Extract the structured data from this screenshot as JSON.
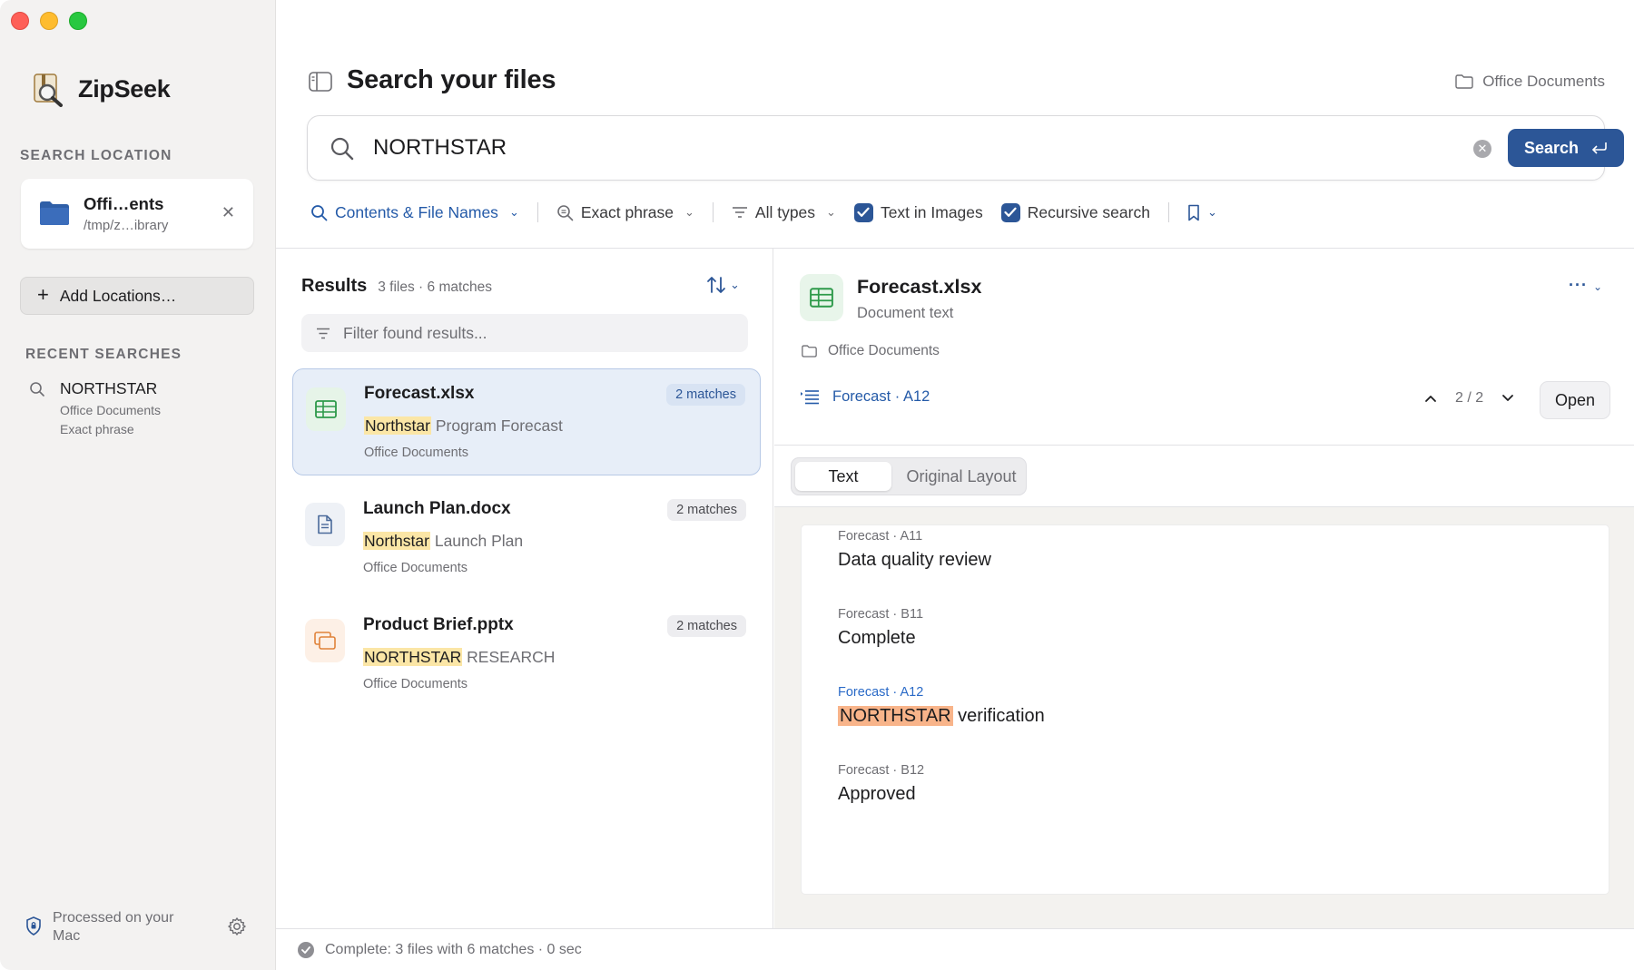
{
  "app": {
    "name": "ZipSeek"
  },
  "sidebar": {
    "search_location_title": "SEARCH LOCATION",
    "location": {
      "name": "Offi…ents",
      "path": "/tmp/z…ibrary"
    },
    "add_locations_label": "Add Locations…",
    "recent_title": "RECENT SEARCHES",
    "recent": [
      {
        "query": "NORTHSTAR",
        "location": "Office Documents",
        "mode": "Exact phrase"
      }
    ],
    "footer_text": "Processed on your Mac"
  },
  "header": {
    "title": "Search your files",
    "location_label": "Office Documents"
  },
  "search": {
    "value": "NORTHSTAR",
    "button_label": "Search"
  },
  "filters": {
    "scope": "Contents & File Names",
    "match": "Exact phrase",
    "types": "All types",
    "text_in_images": {
      "label": "Text in Images",
      "checked": true
    },
    "recursive": {
      "label": "Recursive search",
      "checked": true
    }
  },
  "results": {
    "title": "Results",
    "summary": "3 files · 6 matches",
    "filter_placeholder": "Filter found results...",
    "items": [
      {
        "name": "Forecast.xlsx",
        "highlight": "Northstar",
        "rest": " Program Forecast",
        "location": "Office Documents",
        "badge": "2 matches",
        "selected": true,
        "icon": "spreadsheet-icon"
      },
      {
        "name": "Launch Plan.docx",
        "highlight": "Northstar",
        "rest": " Launch Plan",
        "location": "Office Documents",
        "badge": "2 matches",
        "selected": false,
        "icon": "document-icon"
      },
      {
        "name": "Product Brief.pptx",
        "highlight": "NORTHSTAR",
        "rest": " RESEARCH",
        "location": "Office Documents",
        "badge": "2 matches",
        "selected": false,
        "icon": "presentation-icon"
      }
    ]
  },
  "preview": {
    "file_name": "Forecast.xlsx",
    "kind": "Document text",
    "location": "Office Documents",
    "current_match": "Forecast · A12",
    "position": "2 / 2",
    "open_label": "Open",
    "tabs": [
      "Text",
      "Original Layout"
    ],
    "cells": [
      {
        "label": "Forecast · A11",
        "value": "Data quality review",
        "active": false
      },
      {
        "label": "Forecast · B11",
        "value": "Complete",
        "active": false
      },
      {
        "label": "Forecast · A12",
        "highlight": "NORTHSTAR",
        "rest": " verification",
        "active": true
      },
      {
        "label": "Forecast · B12",
        "value": "Approved",
        "active": false
      }
    ]
  },
  "status": {
    "text": "Complete: 3 files with 6 matches · 0 sec"
  },
  "colors": {
    "accent": "#2c5697",
    "highlight": "#fbe6a6",
    "active_highlight": "#f8b48a"
  }
}
